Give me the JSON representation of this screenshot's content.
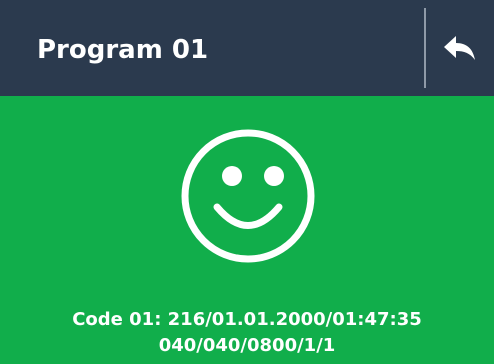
{
  "header": {
    "title": "Program 01",
    "back_icon": "back-arrow-icon",
    "background_color": "#2b3a4e"
  },
  "status": {
    "icon": "smiley-face-icon",
    "background_color": "#11ae4b",
    "code_line_1": "Code 01: 216/01.01.2000/01:47:35",
    "code_line_2": "040/040/0800/1/1"
  }
}
